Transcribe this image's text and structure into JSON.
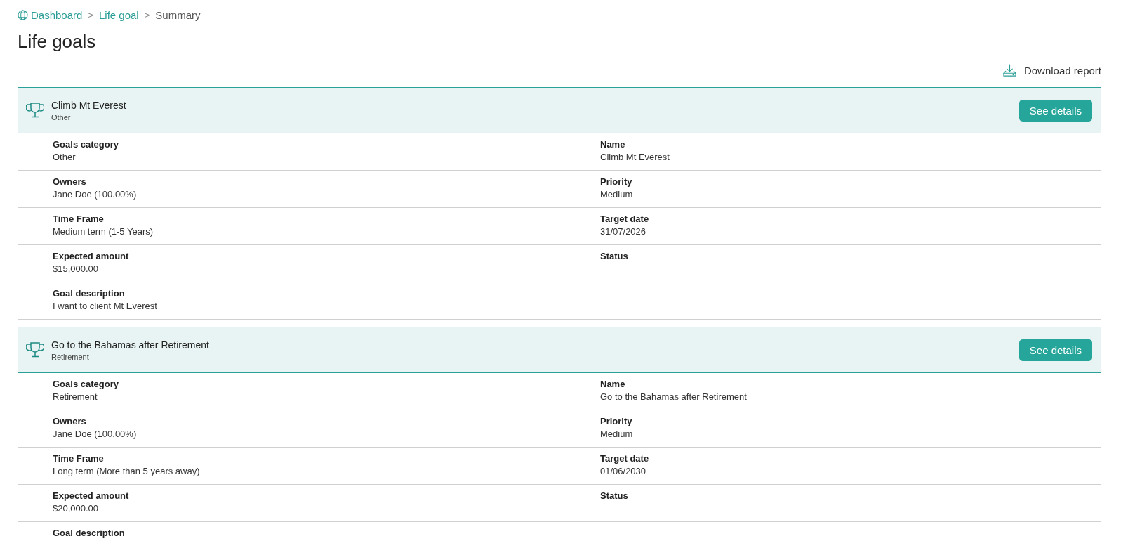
{
  "breadcrumbs": [
    {
      "label": "Dashboard",
      "kind": "link"
    },
    {
      "label": "Life goal",
      "kind": "link"
    },
    {
      "label": "Summary",
      "kind": "current"
    }
  ],
  "separator": ">",
  "page_title": "Life goals",
  "download_button": {
    "label": "Download report"
  },
  "goals": [
    {
      "title": "Climb Mt Everest",
      "subtitle": "Other",
      "button": "See details",
      "rows": [
        [
          {
            "label": "Goals category",
            "value": "Other"
          },
          {
            "label": "Name",
            "value": "Climb Mt Everest"
          }
        ],
        [
          {
            "label": "Owners",
            "value": "Jane Doe (100.00%)"
          },
          {
            "label": "Priority",
            "value": "Medium"
          }
        ],
        [
          {
            "label": "Time Frame",
            "value": "Medium term (1-5 Years)"
          },
          {
            "label": "Target date",
            "value": "31/07/2026"
          }
        ],
        [
          {
            "label": "Expected amount",
            "value": "$15,000.00"
          },
          {
            "label": "Status"
          }
        ],
        [
          {
            "label": "Goal description",
            "value": "I want to client Mt Everest"
          }
        ]
      ]
    },
    {
      "title": "Go to the Bahamas after Retirement",
      "subtitle": "Retirement",
      "button": "See details",
      "rows": [
        [
          {
            "label": "Goals category",
            "value": "Retirement"
          },
          {
            "label": "Name",
            "value": "Go to the Bahamas after Retirement"
          }
        ],
        [
          {
            "label": "Owners",
            "value": "Jane Doe (100.00%)"
          },
          {
            "label": "Priority",
            "value": "Medium"
          }
        ],
        [
          {
            "label": "Time Frame",
            "value": "Long term (More than 5 years away)"
          },
          {
            "label": "Target date",
            "value": "01/06/2030"
          }
        ],
        [
          {
            "label": "Expected amount",
            "value": "$20,000.00"
          },
          {
            "label": "Status"
          }
        ],
        [
          {
            "label": "Goal description"
          }
        ]
      ]
    }
  ]
}
